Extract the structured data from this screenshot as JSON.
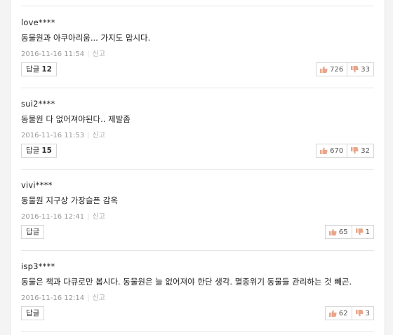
{
  "comments": [
    {
      "author": "love****",
      "text": "동물원과 아쿠아리움... 가지도 맙시다.",
      "timestamp": "2016-11-16 11:54",
      "report_label": "신고",
      "reply_label": "답글",
      "reply_count": "12",
      "likes": "726",
      "dislikes": "33"
    },
    {
      "author": "sui2****",
      "text": "동물원 다 없어져야된다.. 제발좀",
      "timestamp": "2016-11-16 11:53",
      "report_label": "신고",
      "reply_label": "답글",
      "reply_count": "15",
      "likes": "670",
      "dislikes": "32"
    },
    {
      "author": "vivi****",
      "text": "동물원 지구상 가장슬픈 감옥",
      "timestamp": "2016-11-16 12:41",
      "report_label": "신고",
      "reply_label": "답글",
      "reply_count": "",
      "likes": "65",
      "dislikes": "1"
    },
    {
      "author": "isp3****",
      "text": "동물은 책과 다큐로만 봅시다. 동물원은 늘 없어져야 한단 생각. 멸종위기 동물들 관리하는 것 빼곤.",
      "timestamp": "2016-11-16 12:14",
      "report_label": "신고",
      "reply_label": "답글",
      "reply_count": "",
      "likes": "62",
      "dislikes": "3"
    }
  ],
  "colors": {
    "thumb_icon": "#e8a58a",
    "border": "#d6d6d6",
    "meta_text": "#999999"
  },
  "icons": {
    "like": "thumbs-up-icon",
    "dislike": "thumbs-down-icon"
  }
}
